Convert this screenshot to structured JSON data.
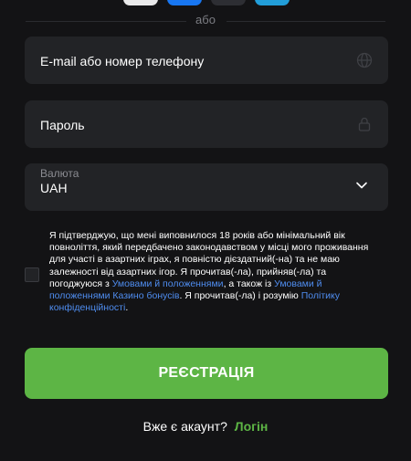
{
  "social": {
    "buttons": [
      {
        "color": "#e9e9ea"
      },
      {
        "color": "#1877f2"
      },
      {
        "color": "#2d2e33"
      },
      {
        "color": "#229ed9"
      }
    ]
  },
  "divider": {
    "text": "або"
  },
  "fields": {
    "email": {
      "label": "E-mail або номер телефону",
      "icon": "globe-icon"
    },
    "password": {
      "label": "Пароль",
      "icon": "lock-icon"
    },
    "currency": {
      "label": "Валюта",
      "value": "UAH",
      "icon": "chevron-down-icon"
    }
  },
  "terms": {
    "part1": "Я підтверджую, що мені виповнилося 18 років або мінімальний вік повноліття, який передбачено законодавством у місці мого проживання для участі в азартних іграх, я повністю дієздатний(-на) та не маю залежності від азартних ігор. Я прочитав(-ла), прийняв(-ла) та погоджуюся з ",
    "link1": "Умовами й положеннями",
    "part2": ", а також із ",
    "link2": "Умовами й положеннями Казино бонусів",
    "part3": ". Я прочитав(-ла) і розумію ",
    "link3": "Політику конфіденційності",
    "part4": "."
  },
  "register_button": {
    "label": "РЕЄСТРАЦІЯ"
  },
  "bottom": {
    "question": "Вже є акаунт?",
    "login": "Логін"
  },
  "colors": {
    "accent": "#5db545",
    "link": "#4f8df0",
    "field_bg": "#222326",
    "background": "#131315"
  }
}
